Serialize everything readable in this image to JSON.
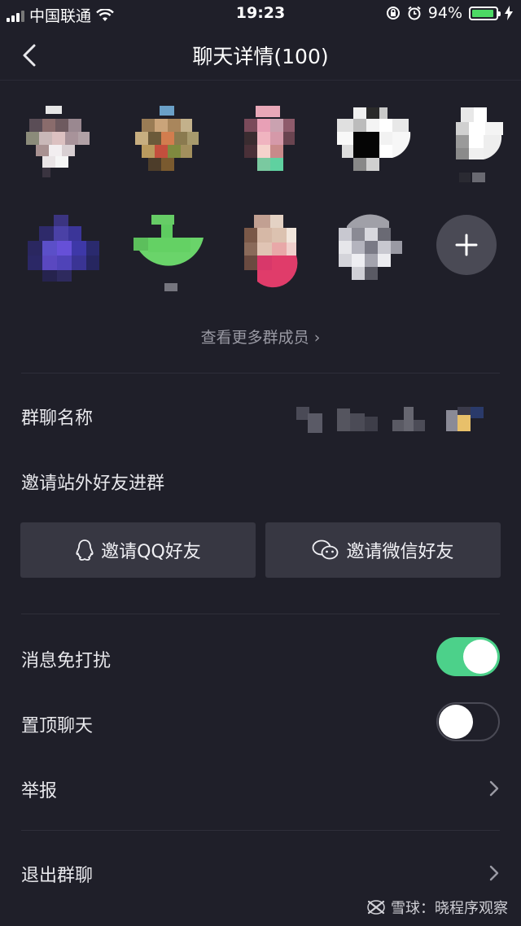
{
  "status_bar": {
    "carrier": "中国联通",
    "time": "19:23",
    "battery_percent": "94%",
    "battery_level": 0.94
  },
  "nav": {
    "title": "聊天详情(100)",
    "back_icon": "chevron-left-icon"
  },
  "members": {
    "more_label": "查看更多群成员 ›",
    "add_icon": "plus-icon"
  },
  "settings": {
    "group_name_label": "群聊名称",
    "invite_external_label": "邀请站外好友进群",
    "invite_qq_label": "邀请QQ好友",
    "invite_wechat_label": "邀请微信好友",
    "dnd_label": "消息免打扰",
    "dnd_on": true,
    "pin_label": "置顶聊天",
    "pin_on": false,
    "report_label": "举报",
    "exit_label": "退出群聊"
  },
  "watermark": "雪球：晓程序观察",
  "colors": {
    "background": "#1f1f29",
    "toggle_on": "#4cd18a",
    "button_bg": "#373742"
  }
}
